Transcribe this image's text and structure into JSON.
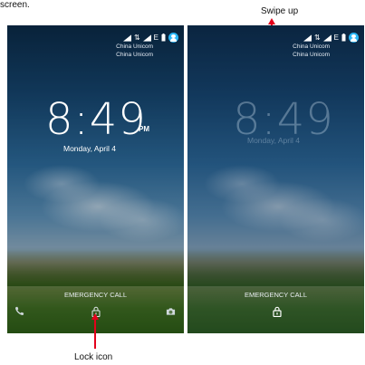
{
  "captions": {
    "top_left": "screen.",
    "swipe_up": "Swipe up",
    "lock_icon": "Lock icon"
  },
  "screens": [
    {
      "carrier_line1": "China Unicom",
      "carrier_line2": "China Unicom",
      "time": "8:49",
      "ampm": "PM",
      "date": "Monday, April 4",
      "emergency": "EMERGENCY CALL"
    },
    {
      "carrier_line1": "China Unicom",
      "carrier_line2": "China Unicom",
      "time": "8:49",
      "date": "Monday, April 4",
      "emergency": "EMERGENCY CALL"
    }
  ],
  "icons": [
    "phone-icon",
    "lock-icon",
    "camera-icon",
    "signal-icon",
    "battery-icon",
    "avatar-icon"
  ],
  "colors": {
    "arrow": "#e3001b",
    "avatar": "#29b6f6"
  }
}
